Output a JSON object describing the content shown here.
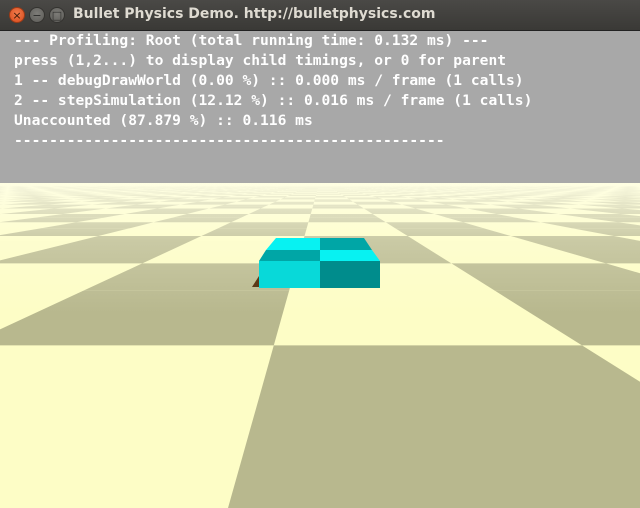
{
  "window": {
    "title": "Bullet Physics Demo. http://bulletphysics.com",
    "close_glyph": "×",
    "minimize_glyph": "−",
    "maximize_glyph": "□"
  },
  "profile": {
    "lines": [
      "--- Profiling: Root (total running time: 0.132 ms) ---",
      "press (1,2...) to display child timings, or 0 for parent",
      "1 -- debugDrawWorld (0.00 %) :: 0.000 ms / frame (1 calls)",
      "2 -- stepSimulation (12.12 %) :: 0.016 ms / frame (1 calls)",
      "Unaccounted (87.879 %) :: 0.116 ms",
      "-------------------------------------------------"
    ]
  },
  "scene": {
    "floor_light": "#fdfdc6",
    "floor_dark": "#b8b88e",
    "box_light": "#07f2f2",
    "box_dark": "#00a6a6",
    "box_front_light": "#08d9d9",
    "box_front_dark": "#008c8c",
    "shadow": "#5c3a18"
  }
}
